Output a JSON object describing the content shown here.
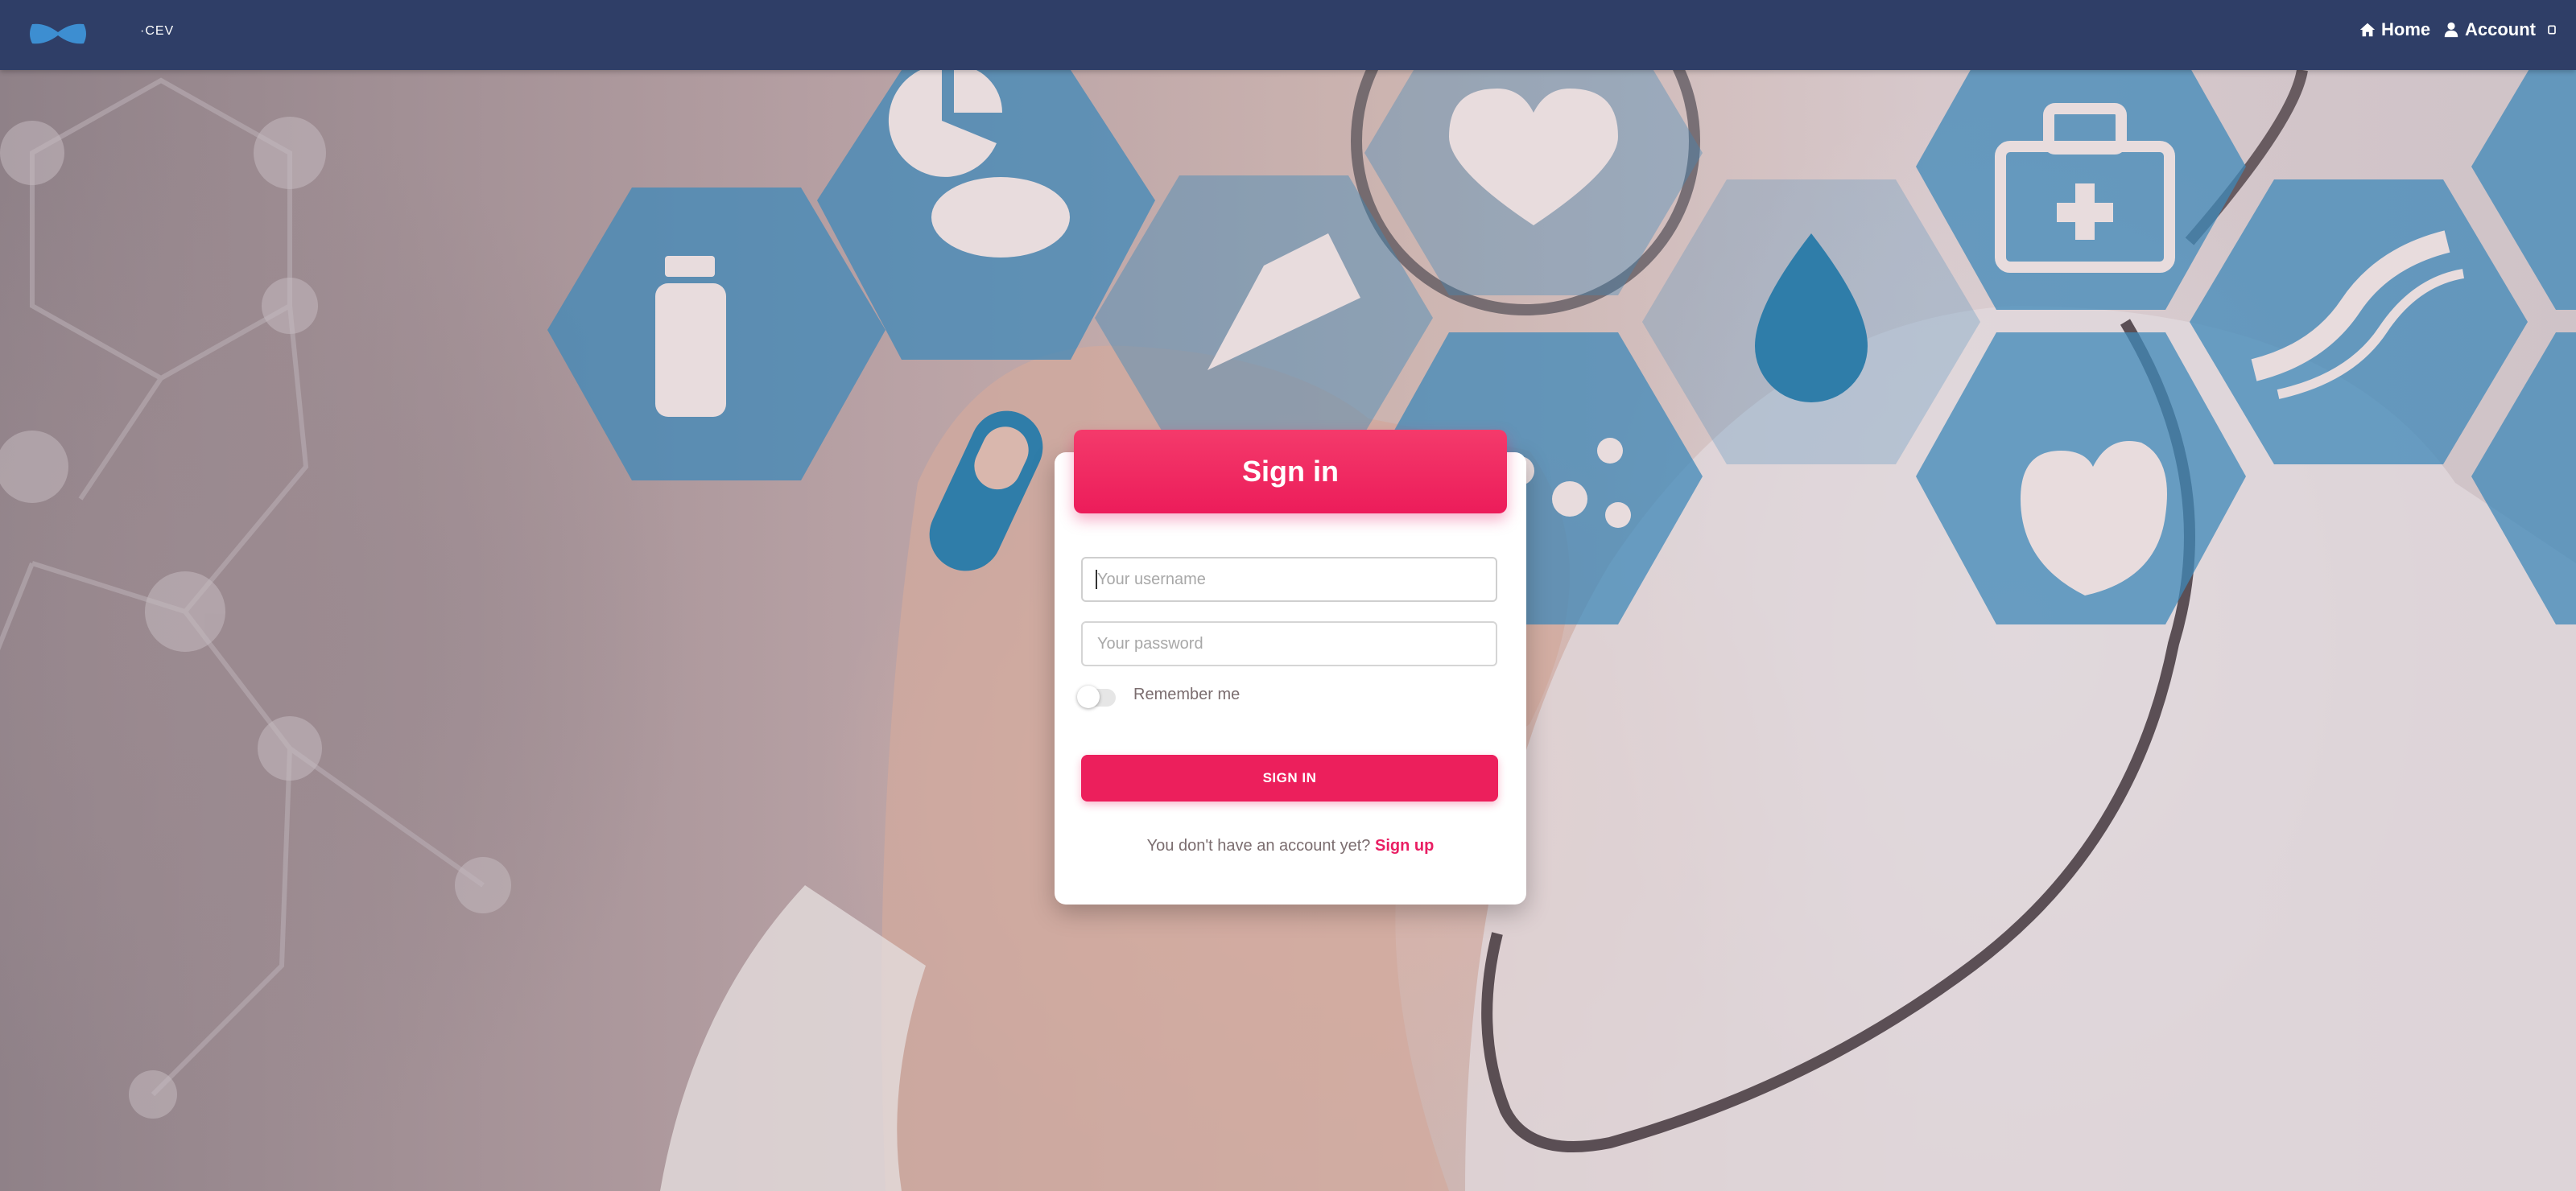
{
  "navbar": {
    "brand_text": "·CEV",
    "home_label": "Home",
    "account_label": "Account"
  },
  "signin": {
    "title": "Sign in",
    "username_placeholder": "Your username",
    "password_placeholder": "Your password",
    "remember_label": "Remember me",
    "remember_checked": false,
    "button_label": "SIGN IN",
    "signup_prompt": "You don't have an account yet?",
    "signup_link": "Sign up"
  },
  "colors": {
    "navbar": "#2f3e67",
    "accent": "#ec1f5c",
    "hex_icon": "#3f88b8"
  },
  "background_icons": [
    "pie-chart-icon",
    "pill-icon",
    "medicine-bottle-icon",
    "thermometer-icon",
    "heart-rate-icon",
    "molecule-icon",
    "blood-drop-icon",
    "first-aid-kit-icon",
    "heart-organ-icon",
    "dna-icon",
    "capsule-icon"
  ]
}
